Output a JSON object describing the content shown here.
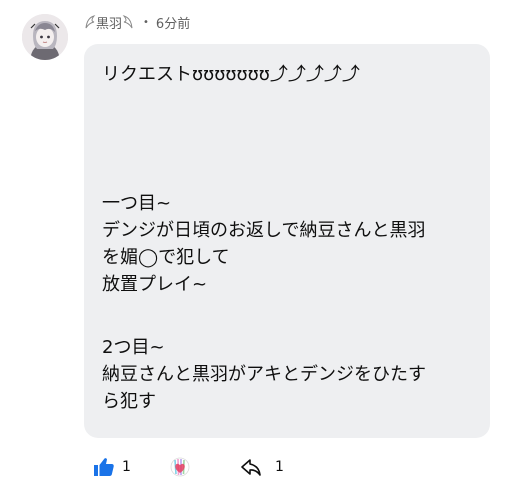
{
  "comment": {
    "author": "❁黒羽❁",
    "author_display": "ὠ黒羽",
    "separator": "•",
    "time": "6分前",
    "lines": [
      "リクエストʊʊʊʊʊʊʊ⤴⤴⤴⤴⤴",
      "",
      "",
      "",
      "",
      "一つ目~",
      "デンジが日頃のお返しで納豆さんと黒羽",
      "を媚◯で犯して",
      "放置プレイ~",
      "",
      "2つ目~",
      "納豆さんと黒羽がアキとデンジをひたす",
      "ら犯す"
    ]
  },
  "actions": {
    "like_icon": "thumbs-up-icon",
    "like_count": "1",
    "like_color": "#1a73e8",
    "reaction_icon": "creator-heart-icon",
    "reply_icon": "reply-arrow-icon",
    "reply_count": "1"
  }
}
